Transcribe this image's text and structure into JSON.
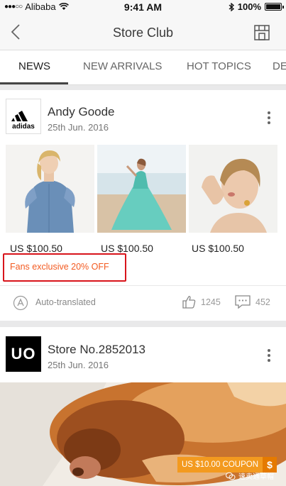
{
  "status_bar": {
    "carrier": "Alibaba",
    "signal_dots": "●●●○○",
    "time": "9:41 AM",
    "battery": "100%"
  },
  "nav": {
    "title": "Store Club",
    "back_icon": "chevron-left-icon",
    "store_icon": "storefront-icon"
  },
  "tabs": [
    {
      "label": "NEWS",
      "active": true
    },
    {
      "label": "NEW ARRIVALS",
      "active": false
    },
    {
      "label": "HOT TOPICS",
      "active": false
    },
    {
      "label": "DE",
      "active": false
    }
  ],
  "posts": [
    {
      "store_name": "Andy Goode",
      "logo_text": "adidas",
      "date": "25th Jun. 2016",
      "products": [
        {
          "price": "US $100.50"
        },
        {
          "price": "US $100.50"
        },
        {
          "price": "US $100.50"
        }
      ],
      "promo": "Fans exclusive 20% OFF",
      "translated_label": "Auto-translated",
      "likes": "1245",
      "comments": "452"
    },
    {
      "store_name": "Store No.2852013",
      "logo_text": "UO",
      "date": "25th Jun. 2016",
      "coupon_label": "US $10.00 COUPON",
      "coupon_symbol": "$",
      "watermark": "速卖通草帽"
    }
  ],
  "colors": {
    "promo_text": "#f35a20",
    "highlight_box": "#d8141b",
    "coupon": "#f39a1f"
  }
}
